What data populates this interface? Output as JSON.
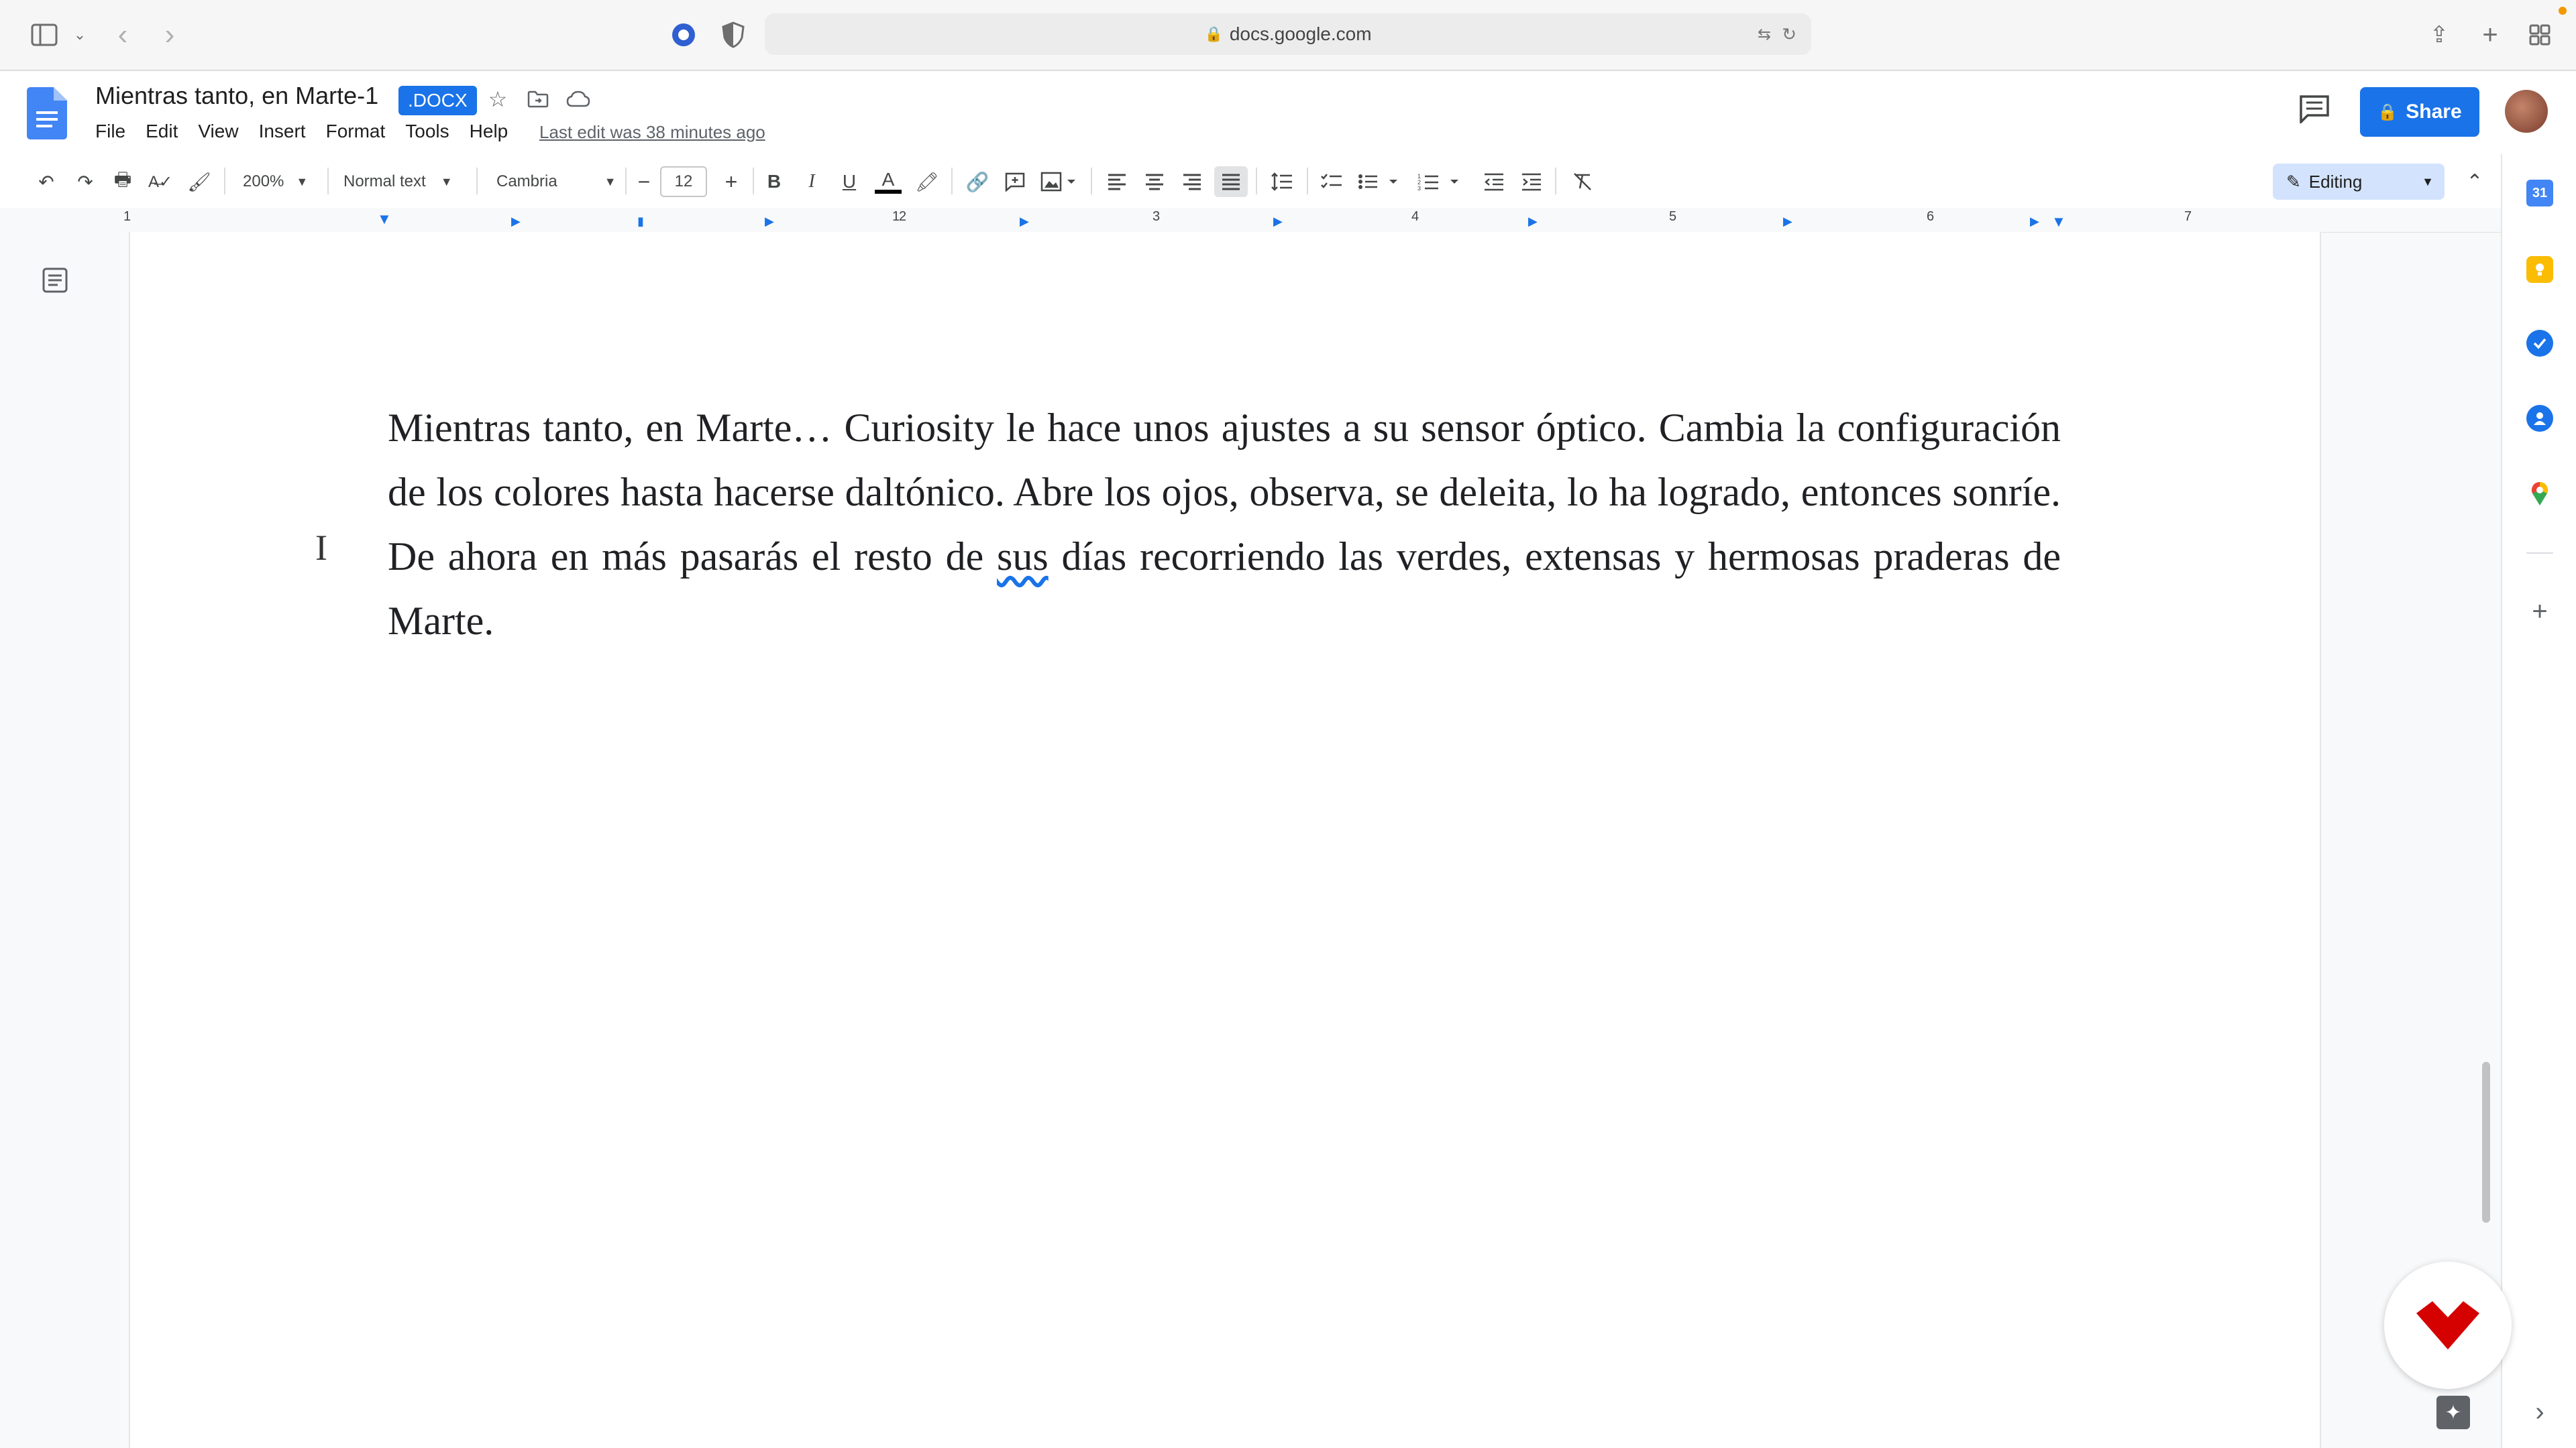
{
  "browser": {
    "url": "docs.google.com"
  },
  "doc": {
    "title": "Mientras tanto, en Marte-1",
    "badge": ".DOCX",
    "last_edit": "Last edit was 38 minutes ago",
    "share_label": "Share",
    "menu": [
      "File",
      "Edit",
      "View",
      "Insert",
      "Format",
      "Tools",
      "Help"
    ]
  },
  "toolbar": {
    "zoom": "200%",
    "style": "Normal text",
    "font": "Cambria",
    "font_size": "12",
    "bold": "B",
    "italic": "I",
    "underline": "U",
    "text_color": "A",
    "mode": "Editing"
  },
  "ruler": {
    "numbers": [
      "1",
      "1",
      "2",
      "3",
      "4",
      "5",
      "6",
      "7"
    ]
  },
  "body": {
    "paragraph_before": "Mientras tanto, en Marte… Curiosity le hace unos ajustes a su sensor óptico. Cambia la configuración de los colores hasta hacerse daltónico. Abre los ojos, observa, se deleita, lo ha logrado, entonces sonríe. De ahora en más pasarás el resto de ",
    "misspelled": "sus",
    "paragraph_after": " días recorriendo las verdes, extensas y hermosas praderas de Marte."
  },
  "colors": {
    "accent": "#1a73e8",
    "fab": "#d50000"
  }
}
